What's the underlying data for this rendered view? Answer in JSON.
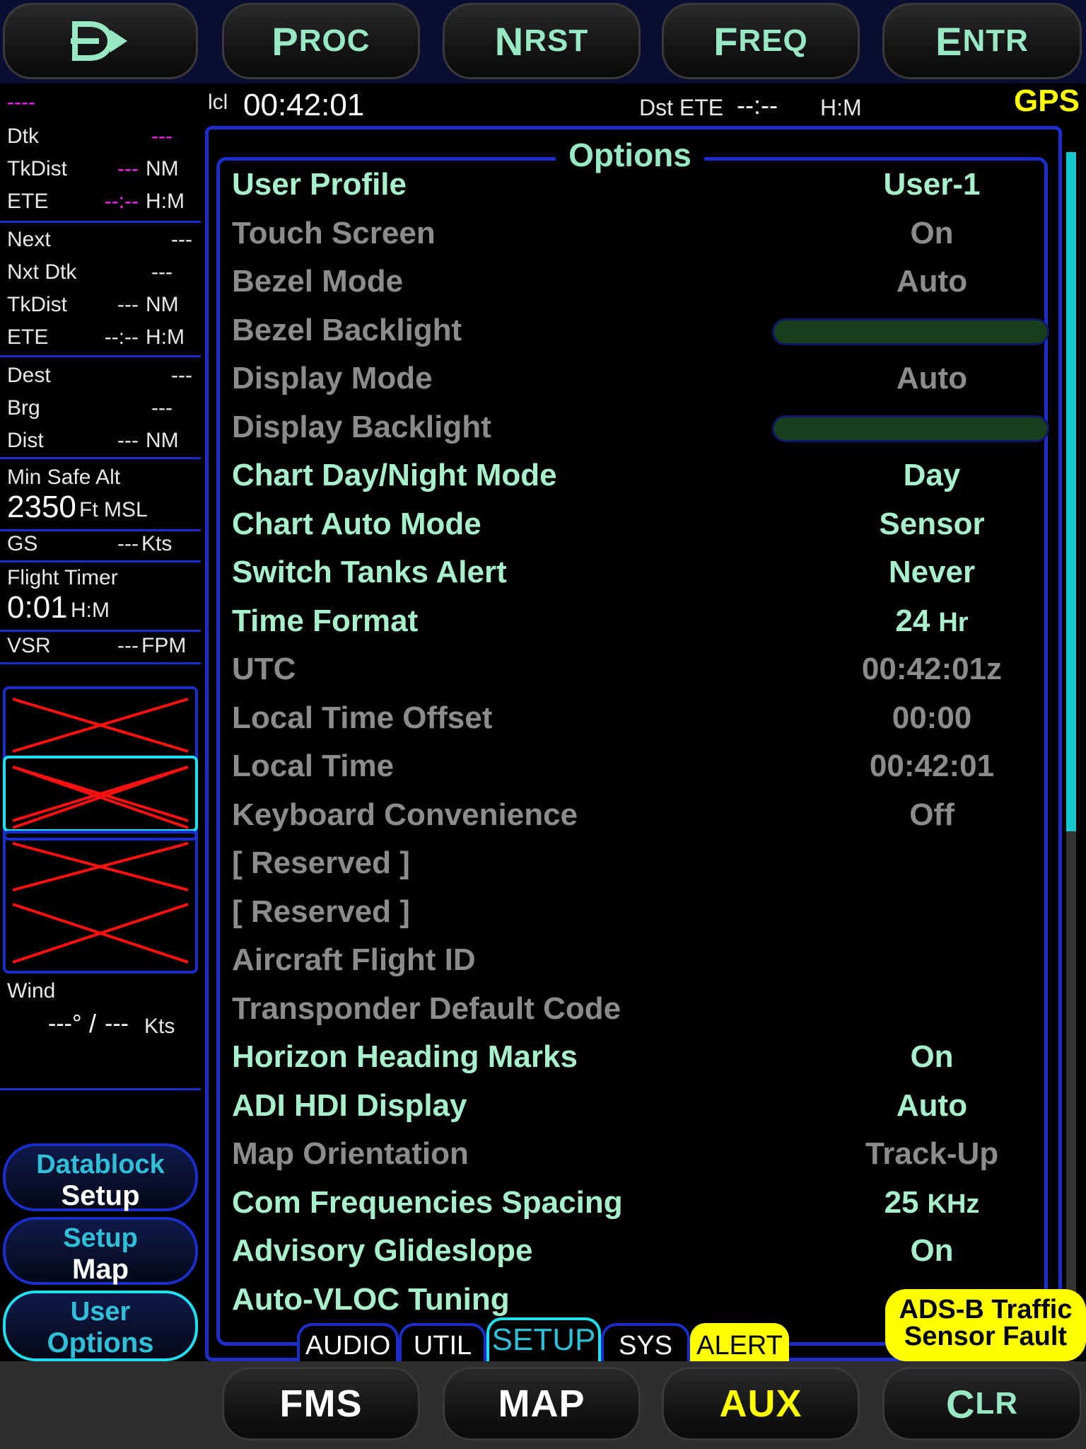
{
  "soft_keys_top": {
    "direct_icon": "direct-to-icon",
    "proc": {
      "first": "P",
      "rest": "ROC"
    },
    "nrst": {
      "first": "N",
      "rest": "RST"
    },
    "freq": {
      "first": "F",
      "rest": "REQ"
    },
    "entr": {
      "first": "E",
      "rest": "NTR"
    }
  },
  "soft_keys_bottom": {
    "fms": "FMS",
    "map": "MAP",
    "aux": "AUX",
    "clr": {
      "first": "C",
      "rest": "LR"
    }
  },
  "status_bar": {
    "lcl_label": "lcl",
    "lcl_time": "00:42:01",
    "dst_ete_label": "Dst ETE",
    "dst_ete_value": "--:--",
    "dst_ete_unit": "H:M",
    "nav_source": "GPS"
  },
  "datablock": {
    "active_waypoint": "----",
    "dtk_label": "Dtk",
    "dtk_value": "---",
    "tkdist_label": "TkDist",
    "tkdist_value": "---",
    "tkdist_unit": "NM",
    "ete_label": "ETE",
    "ete_value": "--:--",
    "ete_unit": "H:M",
    "next_label": "Next",
    "next_value": "---",
    "nxt_dtk_label": "Nxt Dtk",
    "nxt_dtk_value": "---",
    "next_tkdist_label": "TkDist",
    "next_tkdist_value": "---",
    "next_tkdist_unit": "NM",
    "next_ete_label": "ETE",
    "next_ete_value": "--:--",
    "next_ete_unit": "H:M",
    "dest_label": "Dest",
    "dest_value": "---",
    "brg_label": "Brg",
    "brg_value": "---",
    "dist_label": "Dist",
    "dist_value": "---",
    "dist_unit": "NM",
    "min_safe_alt_label": "Min Safe Alt",
    "min_safe_alt_value": "2350",
    "min_safe_alt_unit": "Ft MSL",
    "gs_label": "GS",
    "gs_value": "---",
    "gs_unit": "Kts",
    "flight_timer_label": "Flight Timer",
    "flight_timer_value": "0:01",
    "flight_timer_unit": "H:M",
    "vsr_label": "VSR",
    "vsr_value": "---",
    "vsr_unit": "FPM",
    "wind_label": "Wind",
    "wind_dir": "---°",
    "wind_sep": "/",
    "wind_speed": "---",
    "wind_unit": "Kts"
  },
  "side_buttons": [
    {
      "line1": "Datablock",
      "line2": "Setup"
    },
    {
      "line1": "Setup",
      "line2": "Map"
    },
    {
      "line1": "User",
      "line2": "Options"
    }
  ],
  "options": {
    "title": "Options",
    "rows": [
      {
        "name": "User Profile",
        "value": "User-1",
        "enabled": true
      },
      {
        "name": "Touch Screen",
        "value": "On",
        "enabled": false
      },
      {
        "name": "Bezel Mode",
        "value": "Auto",
        "enabled": false
      },
      {
        "name": "Bezel Backlight",
        "value": "",
        "enabled": false
      },
      {
        "name": "Display Mode",
        "value": "Auto",
        "enabled": false
      },
      {
        "name": "Display Backlight",
        "value": "",
        "enabled": false
      },
      {
        "name": "Chart Day/Night Mode",
        "value": "Day",
        "enabled": true
      },
      {
        "name": "Chart Auto Mode",
        "value": "Sensor",
        "enabled": true
      },
      {
        "name": "Switch Tanks Alert",
        "value": "Never",
        "enabled": true
      },
      {
        "name": "Time Format",
        "value": "24",
        "unit": "Hr",
        "enabled": true
      },
      {
        "name": "UTC",
        "value": "00:42:01z",
        "enabled": false
      },
      {
        "name": "Local Time Offset",
        "value": "00:00",
        "enabled": false
      },
      {
        "name": "Local Time",
        "value": "00:42:01",
        "enabled": false
      },
      {
        "name": "Keyboard Convenience",
        "value": "Off",
        "enabled": false
      },
      {
        "name": "[ Reserved ]",
        "value": "",
        "enabled": false
      },
      {
        "name": "[ Reserved ]",
        "value": "",
        "enabled": false
      },
      {
        "name": "Aircraft Flight ID",
        "value": "",
        "enabled": false
      },
      {
        "name": "Transponder Default Code",
        "value": "",
        "enabled": false
      },
      {
        "name": "Horizon Heading Marks",
        "value": "On",
        "enabled": true
      },
      {
        "name": "ADI HDI Display",
        "value": "Auto",
        "enabled": true
      },
      {
        "name": "Map Orientation",
        "value": "Track-Up",
        "enabled": false
      },
      {
        "name": "Com Frequencies Spacing",
        "value": "25",
        "unit": "KHz",
        "enabled": true
      },
      {
        "name": "Advisory Glideslope",
        "value": "On",
        "enabled": true
      },
      {
        "name": "Auto-VLOC Tuning",
        "value": "",
        "enabled": true
      }
    ]
  },
  "tabs": [
    "AUDIO",
    "UTIL",
    "SETUP",
    "SYS",
    "ALERT"
  ],
  "alert_banner": {
    "line1": "ADS-B Traffic",
    "line2": "Sensor Fault"
  },
  "colors": {
    "accent": "#1c2ec9",
    "active": "#20e0f0",
    "option_enabled": "#a8f0cc",
    "option_disabled": "#8c8c8c",
    "alert": "#ffff00",
    "route": "#ff22ff"
  }
}
